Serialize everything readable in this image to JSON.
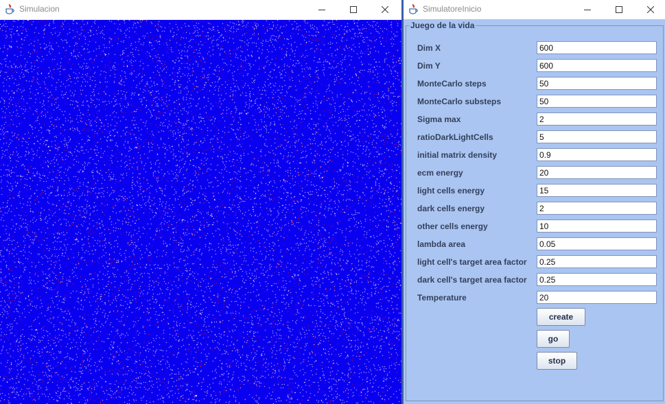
{
  "sim_window": {
    "title": "Simulacion",
    "controls": [
      "minimize-icon",
      "maximize-icon",
      "close-icon"
    ],
    "colors": {
      "background": "#0a00f0",
      "white_cells": "#ffffff",
      "red_cells": "#e0102a"
    }
  },
  "control_window": {
    "title": "SimulatoreInicio",
    "group_title": "Juego de la vida",
    "fields": [
      {
        "label": "Dim X",
        "value": "600"
      },
      {
        "label": "Dim Y",
        "value": "600"
      },
      {
        "label": "MonteCarlo steps",
        "value": "50"
      },
      {
        "label": "MonteCarlo substeps",
        "value": "50"
      },
      {
        "label": "Sigma max",
        "value": "2"
      },
      {
        "label": "ratioDarkLightCells",
        "value": "5"
      },
      {
        "label": "initial matrix density",
        "value": "0.9"
      },
      {
        "label": "ecm energy",
        "value": "20"
      },
      {
        "label": "light cells energy",
        "value": "15"
      },
      {
        "label": "dark cells energy",
        "value": "2"
      },
      {
        "label": "other cells energy",
        "value": "10"
      },
      {
        "label": "lambda area",
        "value": "0.05"
      },
      {
        "label": "light cell's target area factor",
        "value": "0.25"
      },
      {
        "label": "dark cell's target area factor",
        "value": "0.25"
      },
      {
        "label": "Temperature",
        "value": "20"
      }
    ],
    "buttons": {
      "create": "create",
      "go": "go",
      "stop": "stop"
    },
    "colors": {
      "panel": "#abc5f2",
      "label_text": "#33405a"
    }
  }
}
